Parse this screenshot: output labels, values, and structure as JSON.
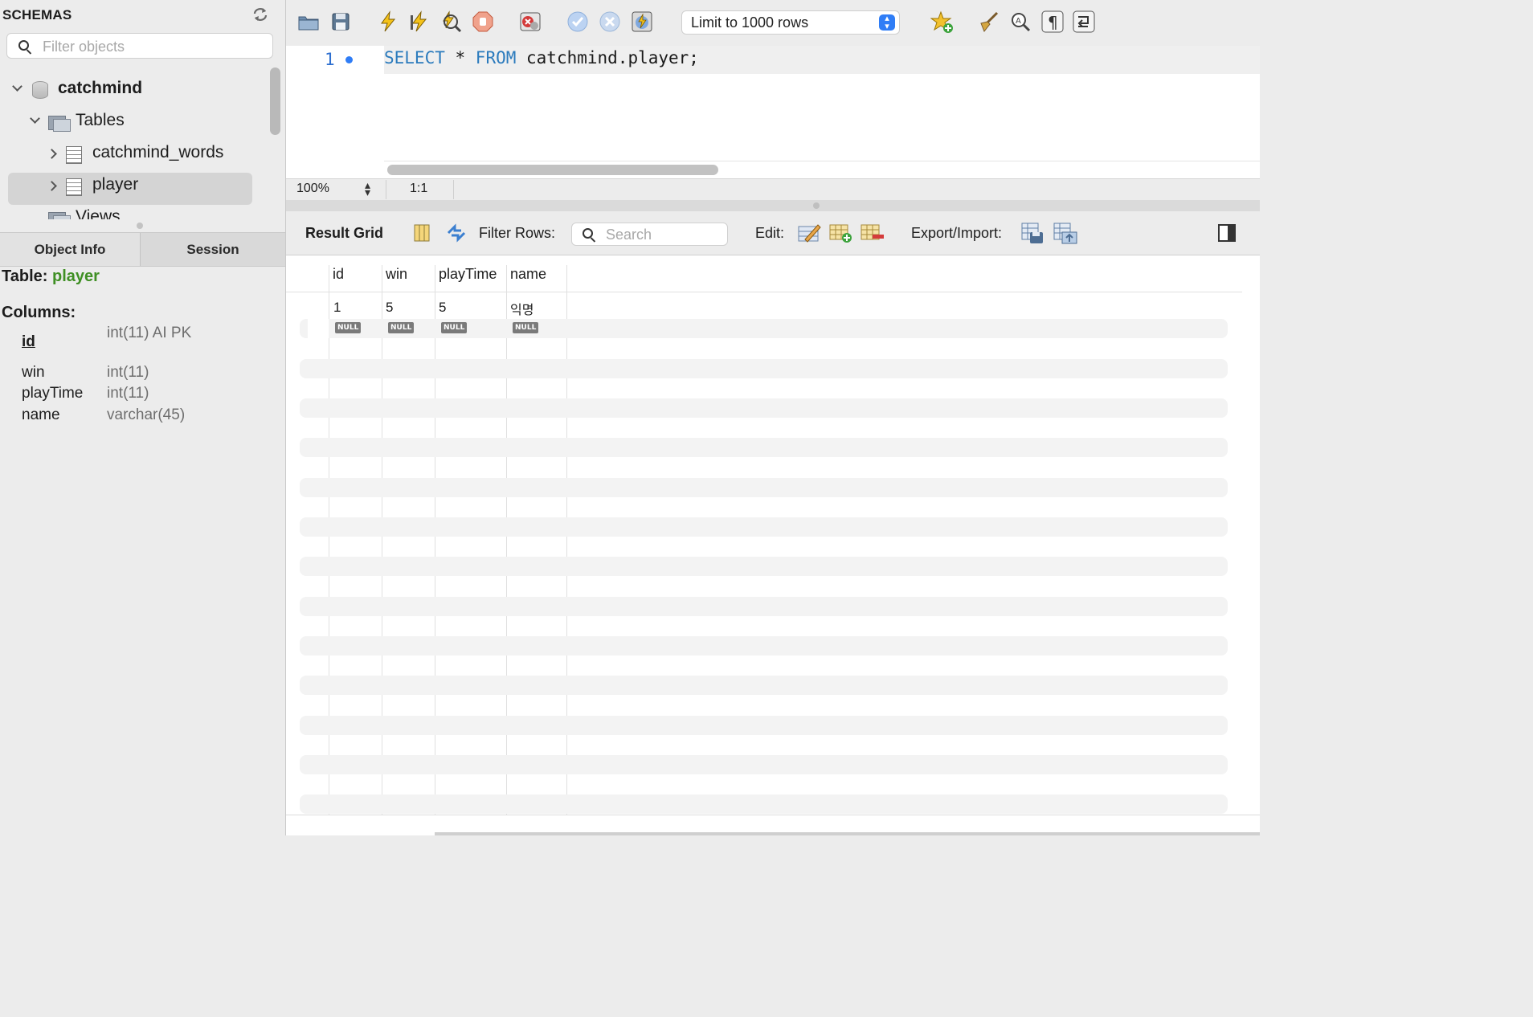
{
  "sidebar": {
    "title": "SCHEMAS",
    "filter_placeholder": "Filter objects",
    "tree": {
      "schema": "catchmind",
      "tables_label": "Tables",
      "tables": [
        "catchmind_words",
        "player"
      ],
      "views_label": "Views"
    },
    "tabs": [
      "Object Info",
      "Session"
    ],
    "info": {
      "table_label": "Table:",
      "table_name": "player",
      "columns_label": "Columns:",
      "columns": [
        {
          "name": "id",
          "type": "int(11) AI PK"
        },
        {
          "name": "win",
          "type": "int(11)"
        },
        {
          "name": "playTime",
          "type": "int(11)"
        },
        {
          "name": "name",
          "type": "varchar(45)"
        }
      ]
    }
  },
  "toolbar": {
    "limit": "Limit to 1000 rows",
    "icons": [
      "open-folder-icon",
      "save-icon",
      "execute-icon",
      "execute-current-icon",
      "explain-icon",
      "stop-icon",
      "toggle-error-icon",
      "commit-icon",
      "rollback-icon",
      "autocommit-icon",
      "beautify-icon",
      "find-icon",
      "invisibles-icon",
      "wrap-icon"
    ]
  },
  "editor": {
    "line_number": "1",
    "sql_keyword1": "SELECT",
    "sql_star": " * ",
    "sql_keyword2": "FROM",
    "sql_rest": " catchmind.player;",
    "zoom": "100%",
    "position": "1:1"
  },
  "result_bar": {
    "title": "Result Grid",
    "filter_label": "Filter Rows:",
    "search_placeholder": "Search",
    "edit_label": "Edit:",
    "export_label": "Export/Import:"
  },
  "grid": {
    "columns": [
      "id",
      "win",
      "playTime",
      "name"
    ],
    "rows": [
      [
        "1",
        "5",
        "5",
        "익명"
      ],
      [
        "NULL",
        "NULL",
        "NULL",
        "NULL"
      ]
    ]
  },
  "colors": {
    "keyword": "#2b7bbd",
    "table_name": "#3f8f24",
    "accent": "#2f7df6"
  }
}
